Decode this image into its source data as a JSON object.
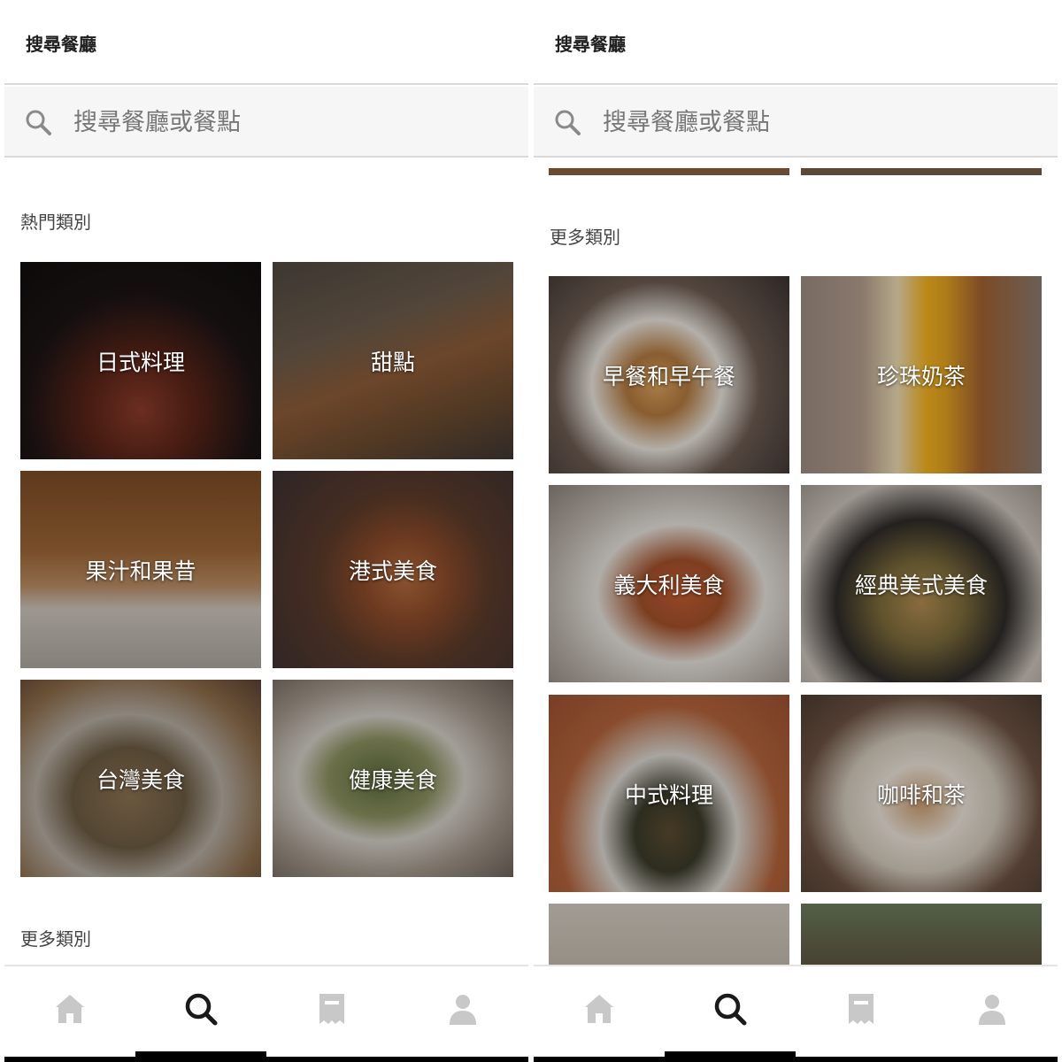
{
  "panels": [
    {
      "title": "搜尋餐廳",
      "search": {
        "placeholder": "搜尋餐廳或餐點"
      },
      "popular_heading": "熱門類別",
      "more_heading": "更多類別",
      "tiles": [
        {
          "label": "日式料理"
        },
        {
          "label": "甜點"
        },
        {
          "label": "果汁和果昔"
        },
        {
          "label": "港式美食"
        },
        {
          "label": "台灣美食"
        },
        {
          "label": "健康美食"
        }
      ],
      "nav": {
        "active": "search"
      }
    },
    {
      "title": "搜尋餐廳",
      "search": {
        "placeholder": "搜尋餐廳或餐點"
      },
      "more_heading": "更多類別",
      "tiles": [
        {
          "label": "早餐和早午餐"
        },
        {
          "label": "珍珠奶茶"
        },
        {
          "label": "義大利美食"
        },
        {
          "label": "經典美式美食"
        },
        {
          "label": "中式料理"
        },
        {
          "label": "咖啡和茶"
        },
        {
          "label": ""
        },
        {
          "label": ""
        }
      ],
      "nav": {
        "active": "search"
      }
    }
  ],
  "nav_items": [
    {
      "icon": "home-icon"
    },
    {
      "icon": "search-icon"
    },
    {
      "icon": "receipt-icon"
    },
    {
      "icon": "account-icon"
    }
  ],
  "colors": {
    "nav_inactive": "#c8c8c8",
    "nav_active": "#1a1a1a",
    "search_icon": "#8a8a8a"
  }
}
